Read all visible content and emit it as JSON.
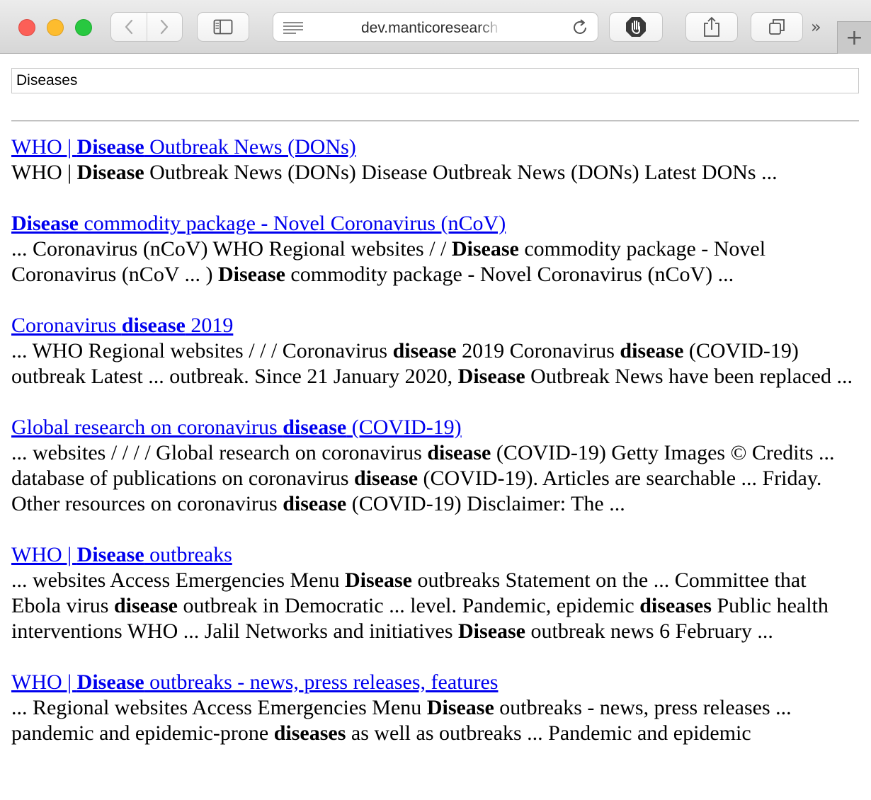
{
  "browser": {
    "url": "dev.manticoresearch",
    "overflow_label": "»",
    "new_tab_label": "+"
  },
  "search": {
    "value": "Diseases"
  },
  "results": [
    {
      "title": [
        {
          "t": "WHO | ",
          "b": false
        },
        {
          "t": "Disease",
          "b": true
        },
        {
          "t": " Outbreak News (DONs)",
          "b": false
        }
      ],
      "snippet": [
        {
          "t": "WHO | ",
          "b": false
        },
        {
          "t": "Disease",
          "b": true
        },
        {
          "t": " Outbreak News (DONs) Disease Outbreak News (DONs) Latest DONs ...",
          "b": false
        }
      ]
    },
    {
      "title": [
        {
          "t": "Disease",
          "b": true
        },
        {
          "t": " commodity package - Novel Coronavirus (nCoV)",
          "b": false
        }
      ],
      "snippet": [
        {
          "t": "... Coronavirus (nCoV) WHO Regional websites / / ",
          "b": false
        },
        {
          "t": "Disease",
          "b": true
        },
        {
          "t": " commodity package - Novel Coronavirus (nCoV ... ) ",
          "b": false
        },
        {
          "t": "Disease",
          "b": true
        },
        {
          "t": " commodity package - Novel Coronavirus (nCoV) ...",
          "b": false
        }
      ]
    },
    {
      "title": [
        {
          "t": "Coronavirus ",
          "b": false
        },
        {
          "t": "disease",
          "b": true
        },
        {
          "t": " 2019",
          "b": false
        }
      ],
      "snippet": [
        {
          "t": "... WHO Regional websites / / / Coronavirus ",
          "b": false
        },
        {
          "t": "disease",
          "b": true
        },
        {
          "t": " 2019 Coronavirus ",
          "b": false
        },
        {
          "t": "disease",
          "b": true
        },
        {
          "t": " (COVID-19) outbreak Latest ... outbreak. Since 21 January 2020, ",
          "b": false
        },
        {
          "t": "Disease",
          "b": true
        },
        {
          "t": " Outbreak News have been replaced ...",
          "b": false
        }
      ]
    },
    {
      "title": [
        {
          "t": "Global research on coronavirus ",
          "b": false
        },
        {
          "t": "disease",
          "b": true
        },
        {
          "t": " (COVID-19)",
          "b": false
        }
      ],
      "snippet": [
        {
          "t": "... websites / / / / Global research on coronavirus ",
          "b": false
        },
        {
          "t": "disease",
          "b": true
        },
        {
          "t": " (COVID-19) Getty Images © Credits ... database of publications on coronavirus ",
          "b": false
        },
        {
          "t": "disease",
          "b": true
        },
        {
          "t": " (COVID-19). Articles are searchable ... Friday. Other resources on coronavirus ",
          "b": false
        },
        {
          "t": "disease",
          "b": true
        },
        {
          "t": " (COVID-19) Disclaimer: The ...",
          "b": false
        }
      ]
    },
    {
      "title": [
        {
          "t": "WHO | ",
          "b": false
        },
        {
          "t": "Disease",
          "b": true
        },
        {
          "t": " outbreaks",
          "b": false
        }
      ],
      "snippet": [
        {
          "t": "... websites Access Emergencies Menu ",
          "b": false
        },
        {
          "t": "Disease",
          "b": true
        },
        {
          "t": " outbreaks Statement on the ... Committee that Ebola virus ",
          "b": false
        },
        {
          "t": "disease",
          "b": true
        },
        {
          "t": " outbreak in Democratic ... level. Pandemic, epidemic ",
          "b": false
        },
        {
          "t": "diseases",
          "b": true
        },
        {
          "t": " Public health interventions WHO ... Jalil Networks and initiatives ",
          "b": false
        },
        {
          "t": "Disease",
          "b": true
        },
        {
          "t": " outbreak news 6 February ...",
          "b": false
        }
      ]
    },
    {
      "title": [
        {
          "t": "WHO | ",
          "b": false
        },
        {
          "t": "Disease",
          "b": true
        },
        {
          "t": " outbreaks - news, press releases, features",
          "b": false
        }
      ],
      "snippet": [
        {
          "t": "... Regional websites Access Emergencies Menu ",
          "b": false
        },
        {
          "t": "Disease",
          "b": true
        },
        {
          "t": " outbreaks - news, press releases ... pandemic and epidemic-prone ",
          "b": false
        },
        {
          "t": "diseases",
          "b": true
        },
        {
          "t": " as well as outbreaks ... Pandemic and epidemic",
          "b": false
        }
      ]
    }
  ]
}
